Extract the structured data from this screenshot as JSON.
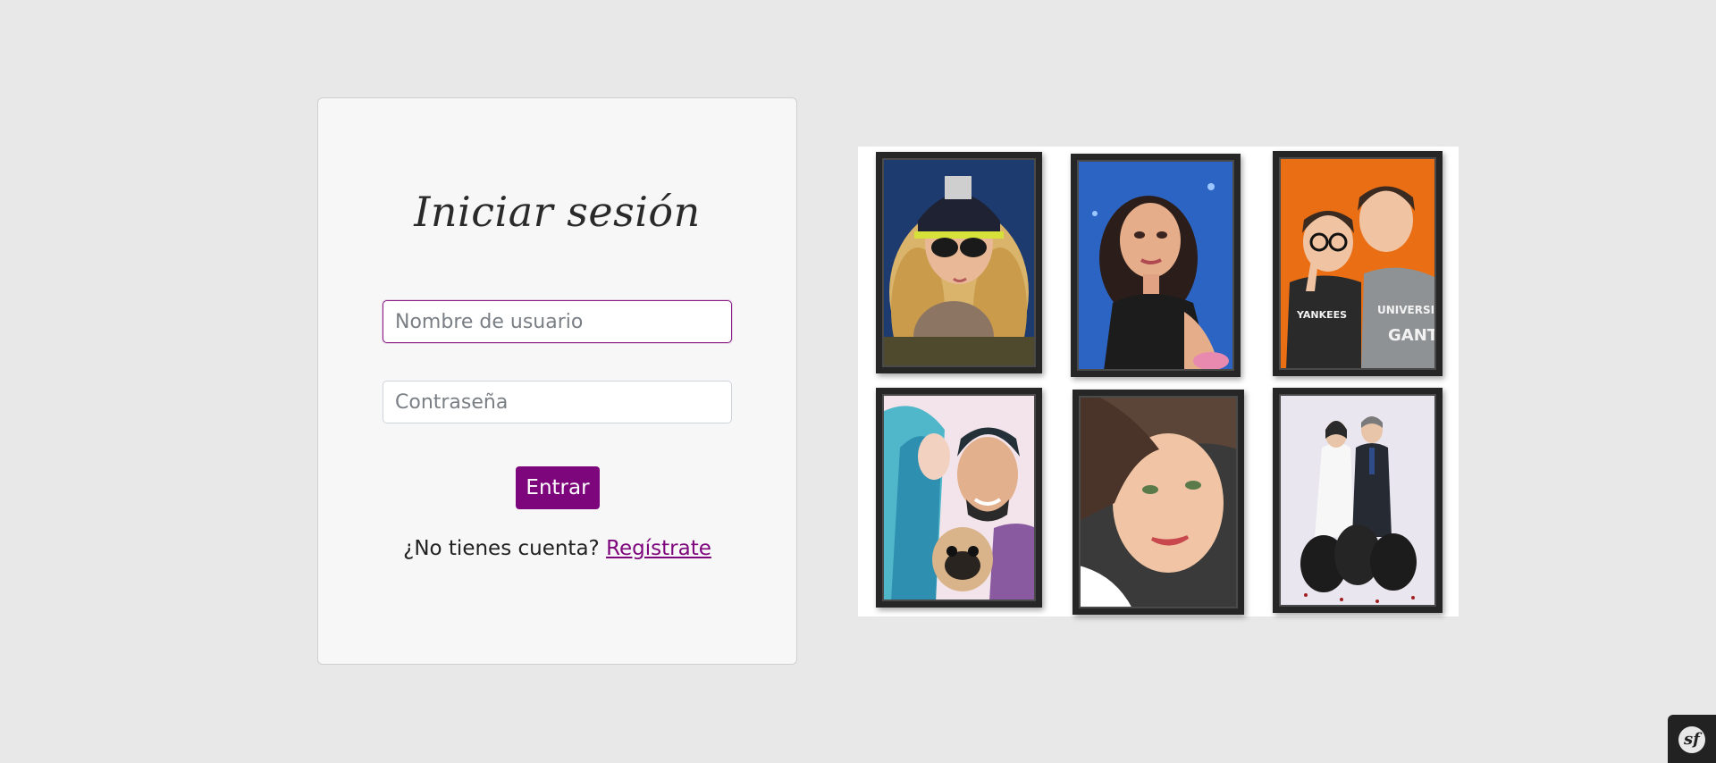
{
  "login": {
    "title": "Iniciar sesión",
    "username_placeholder": "Nombre de usuario",
    "password_placeholder": "Contraseña",
    "submit_label": "Entrar",
    "register_prompt": "¿No tienes cuenta?",
    "register_link": "Regístrate"
  },
  "gallery": {
    "portraits": [
      "portrait-woman-cap-sunglasses",
      "portrait-woman-blue-background",
      "portrait-two-boys-orange-background",
      "portrait-couple-with-pug",
      "portrait-woman-closeup",
      "portrait-couple-with-dogs"
    ]
  },
  "toolbar": {
    "icon": "symfony-logo-icon",
    "glyph": "sf"
  },
  "colors": {
    "accent": "#7d067d",
    "background": "#e8e8e8",
    "card": "#f7f7f7"
  }
}
